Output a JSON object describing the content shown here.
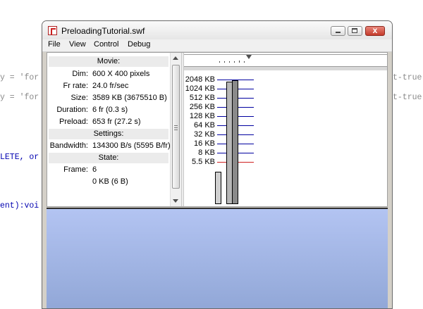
{
  "background_code": {
    "lines": [
      {
        "left": "y = 'for",
        "right": "t-true"
      },
      {
        "left": "y = 'for",
        "right": "t-true"
      },
      {
        "left": "LETE, or",
        "right": ""
      },
      {
        "left": "ent):voi",
        "right": ""
      }
    ]
  },
  "window": {
    "title": "PreloadingTutorial.swf",
    "close_glyph": "x"
  },
  "menu": {
    "items": [
      "File",
      "View",
      "Control",
      "Debug"
    ]
  },
  "properties": {
    "movie_header": "Movie:",
    "movie": [
      {
        "label": "Dim:",
        "value": "600 X 400 pixels"
      },
      {
        "label": "Fr rate:",
        "value": "24.0 fr/sec"
      },
      {
        "label": "Size:",
        "value": "3589 KB (3675510 B)"
      },
      {
        "label": "Duration:",
        "value": "6 fr (0.3 s)"
      },
      {
        "label": "Preload:",
        "value": "653 fr (27.2 s)"
      }
    ],
    "settings_header": "Settings:",
    "settings": [
      {
        "label": "Bandwidth:",
        "value": "134300 B/s (5595 B/fr)"
      }
    ],
    "state_header": "State:",
    "state": [
      {
        "label": "Frame:",
        "value": "6"
      },
      {
        "label": "",
        "value": "0 KB (6 B)"
      }
    ]
  },
  "bandwidth_graph": {
    "scale_labels": [
      "2048 KB",
      "1024 KB",
      "512 KB",
      "256 KB",
      "128 KB",
      "64 KB",
      "32 KB",
      "16 KB",
      "8 KB",
      "5.5 KB"
    ],
    "limit_label": "5.5 KB",
    "line_color": "#0000a0",
    "limit_color": "#d02020",
    "frames": [
      {
        "fill": "#d0d0d0",
        "level": 0.26
      },
      {
        "fill": "#ffffff",
        "level": 0
      },
      {
        "fill": "#b8b8b8",
        "level": 0.99
      },
      {
        "fill": "#8a8a8a",
        "level": 1.0
      }
    ]
  }
}
